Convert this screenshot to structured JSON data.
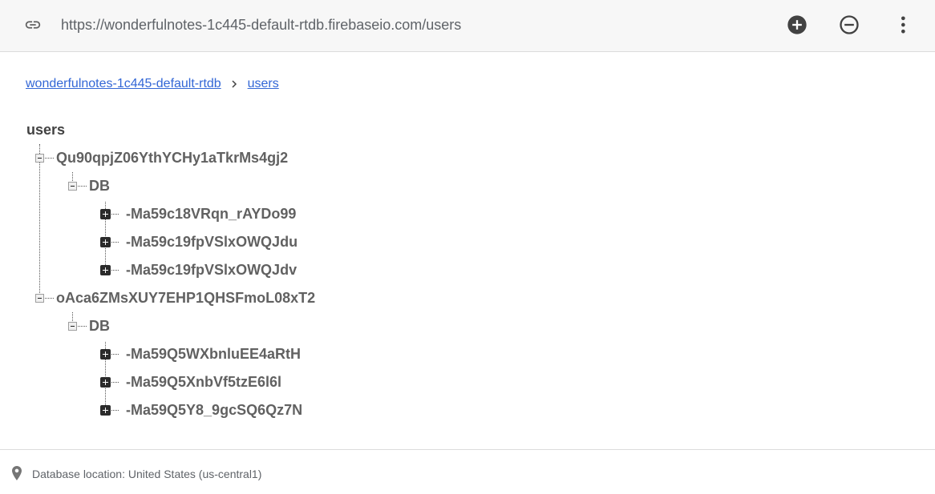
{
  "toolbar": {
    "url": "https://wonderfulnotes-1c445-default-rtdb.firebaseio.com/users",
    "icons": {
      "link": "link-icon",
      "add": "add-circle-icon",
      "remove": "remove-circle-icon",
      "more": "more-vert-icon"
    }
  },
  "breadcrumb": {
    "items": [
      "wonderfulnotes-1c445-default-rtdb",
      "users"
    ]
  },
  "tree": {
    "root": "users",
    "users": [
      {
        "id": "Qu90qpjZ06YthYCHy1aTkrMs4gj2",
        "child": "DB",
        "entries": [
          "-Ma59c18VRqn_rAYDo99",
          "-Ma59c19fpVSlxOWQJdu",
          "-Ma59c19fpVSlxOWQJdv"
        ]
      },
      {
        "id": "oAca6ZMsXUY7EHP1QHSFmoL08xT2",
        "child": "DB",
        "entries": [
          "-Ma59Q5WXbnluEE4aRtH",
          "-Ma59Q5XnbVf5tzE6l6l",
          "-Ma59Q5Y8_9gcSQ6Qz7N"
        ]
      }
    ]
  },
  "footer": {
    "location_text": "Database location: United States (us-central1)"
  }
}
